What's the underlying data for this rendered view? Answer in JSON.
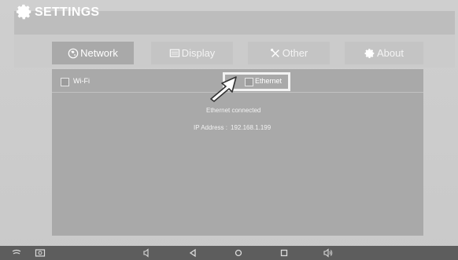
{
  "header": {
    "title": "SETTINGS",
    "icon": "gear-icon"
  },
  "tabs": [
    {
      "label": "Network",
      "icon": "globe-icon",
      "active": true
    },
    {
      "label": "Display",
      "icon": "display-icon",
      "active": false
    },
    {
      "label": "Other",
      "icon": "tools-icon",
      "active": false
    },
    {
      "label": "About",
      "icon": "gear-icon",
      "active": false
    }
  ],
  "network": {
    "wifi_label": "Wi-Fi",
    "ethernet_label": "Ethernet",
    "status": "Ethernet connected",
    "ip_label": "IP Address :",
    "ip_value": "192.168.1.199"
  },
  "navbar": {
    "icons": [
      "signal-icon",
      "screenshot-icon",
      "volume-down-icon",
      "back-icon",
      "home-icon",
      "recents-icon",
      "volume-up-icon"
    ]
  },
  "colors": {
    "panel": "#a9a9a9",
    "tab_active": "#a9a9a9",
    "tab_inactive": "#c4c4c4",
    "navbar": "#5d5d5d",
    "text": "#ffffff"
  }
}
